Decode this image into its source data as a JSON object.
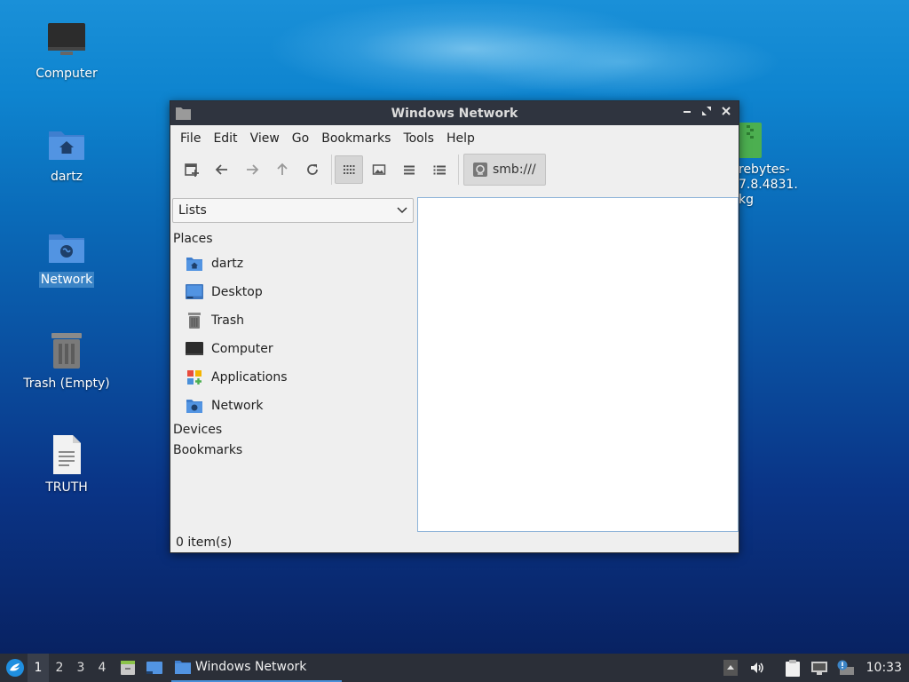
{
  "desktop": {
    "icons": [
      {
        "label": "Computer"
      },
      {
        "label": "dartz"
      },
      {
        "label": "Network"
      },
      {
        "label": "Trash (Empty)"
      },
      {
        "label": "TRUTH"
      }
    ],
    "partial_file": {
      "line1": "rebytes-",
      "line2": "7.8.4831.",
      "line3": "kg"
    }
  },
  "window": {
    "title": "Windows Network",
    "menu": [
      "File",
      "Edit",
      "View",
      "Go",
      "Bookmarks",
      "Tools",
      "Help"
    ],
    "location": "smb:///",
    "sidebar": {
      "selector": "Lists",
      "places_header": "Places",
      "places": [
        {
          "label": "dartz",
          "icon": "home-folder-icon"
        },
        {
          "label": "Desktop",
          "icon": "desktop-icon"
        },
        {
          "label": "Trash",
          "icon": "trash-icon"
        },
        {
          "label": "Computer",
          "icon": "computer-icon"
        },
        {
          "label": "Applications",
          "icon": "applications-icon"
        },
        {
          "label": "Network",
          "icon": "network-folder-icon"
        }
      ],
      "devices_header": "Devices",
      "bookmarks_header": "Bookmarks"
    },
    "status": "0 item(s)"
  },
  "taskbar": {
    "workspaces": [
      "1",
      "2",
      "3",
      "4"
    ],
    "active_workspace": "1",
    "task_label": "Windows Network",
    "clock": "10:33"
  },
  "colors": {
    "titlebar": "#2f343f",
    "selection": "#3b84c6",
    "folder_blue": "#5294e2",
    "taskbar": "#2b2f38"
  }
}
